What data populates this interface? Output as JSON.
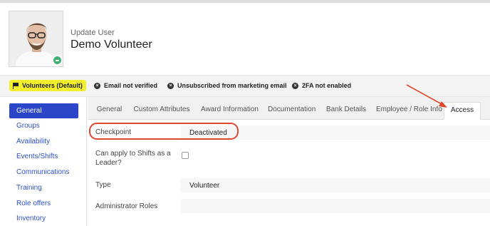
{
  "header": {
    "subtitle": "Update User",
    "title": "Demo Volunteer"
  },
  "badges": [
    {
      "label": "Volunteers (Default)",
      "icon": "flag-icon"
    },
    {
      "label": "Email not verified",
      "icon": "x-circle-icon"
    },
    {
      "label": "Unsubscribed from marketing email",
      "icon": "x-circle-icon"
    },
    {
      "label": "2FA not enabled",
      "icon": "x-circle-icon"
    }
  ],
  "sidebar": {
    "items": [
      {
        "label": "General",
        "active": true
      },
      {
        "label": "Groups"
      },
      {
        "label": "Availability"
      },
      {
        "label": "Events/Shifts"
      },
      {
        "label": "Communications"
      },
      {
        "label": "Training"
      },
      {
        "label": "Role offers"
      },
      {
        "label": "Inventory"
      }
    ]
  },
  "tabs": [
    {
      "label": "General"
    },
    {
      "label": "Custom Attributes"
    },
    {
      "label": "Award Information"
    },
    {
      "label": "Documentation"
    },
    {
      "label": "Bank Details"
    },
    {
      "label": "Employee / Role Info"
    },
    {
      "label": "Access",
      "active": true
    }
  ],
  "form": {
    "checkpoint": {
      "label": "Checkpoint",
      "value": "Deactivated"
    },
    "leader": {
      "label_line1": "Can apply to Shifts as a",
      "label_line2": "Leader?",
      "checked": false
    },
    "type": {
      "label": "Type",
      "value": "Volunteer"
    },
    "admin_roles": {
      "label": "Administrator Roles",
      "value": ""
    }
  },
  "colors": {
    "accent": "#2b46c9",
    "badge_primary": "#f3ef2d",
    "annotation": "#e0472d",
    "status_online": "#3cb371"
  }
}
